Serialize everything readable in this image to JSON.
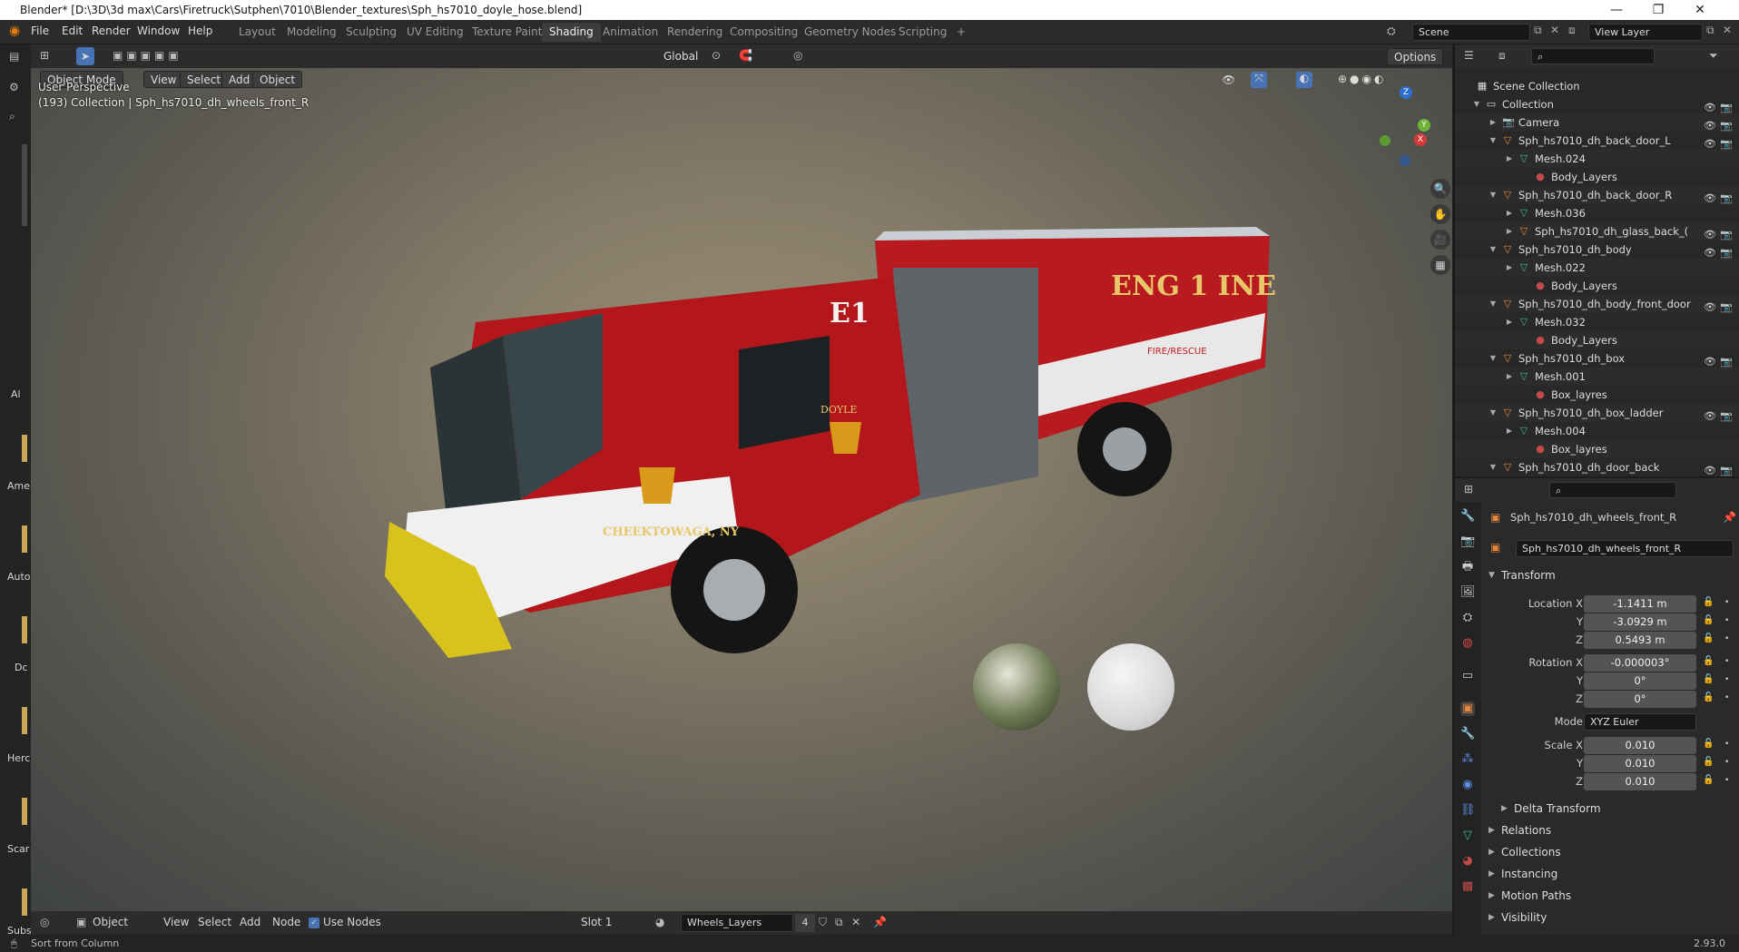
{
  "window": {
    "title": "Blender* [D:\\3D\\3d max\\Cars\\Firetruck\\Sutphen\\7010\\Blender_textures\\Sph_hs7010_doyle_hose.blend]",
    "minimize": "—",
    "maximize": "❐",
    "close": "✕"
  },
  "menu": [
    "File",
    "Edit",
    "Render",
    "Window",
    "Help"
  ],
  "workspaces": [
    "Layout",
    "Modeling",
    "Sculpting",
    "UV Editing",
    "Texture Paint",
    "Shading",
    "Animation",
    "Rendering",
    "Compositing",
    "Geometry Nodes",
    "Scripting",
    "+"
  ],
  "active_workspace": "Shading",
  "scene": {
    "name": "Scene",
    "view_layer": "View Layer"
  },
  "viewport_header": {
    "mode": "Object Mode",
    "menus": [
      "View",
      "Select",
      "Add",
      "Object"
    ],
    "orientation": "Global",
    "options": "Options"
  },
  "viewport": {
    "perspective": "User Perspective",
    "collection_info": "(193) Collection | Sph_hs7010_dh_wheels_front_R",
    "gizmo_axes": [
      "Z",
      "Y",
      "X"
    ]
  },
  "truck_text": {
    "unit": "E1",
    "engine": "ENG 1 INE",
    "rescue": "FIRE/RESCUE",
    "city": "CHEEKTOWAGA, NY",
    "company": "DOYLE"
  },
  "node_header": {
    "object": "Object",
    "menus": [
      "View",
      "Select",
      "Add",
      "Node"
    ],
    "use_nodes": "Use Nodes",
    "slot": "Slot 1",
    "material": "Wheels_Layers",
    "users": "4"
  },
  "left_toolbar_labels": [
    "Al",
    "Ame",
    "Auto",
    "Dc",
    "Herc",
    "Scar",
    "Subs"
  ],
  "status": {
    "left": "Sort from Column",
    "version": "2.93.0"
  },
  "outliner": {
    "root": "Scene Collection",
    "rows": [
      {
        "label": "Collection",
        "depth": 0,
        "icon": "collection",
        "vis": true
      },
      {
        "label": "Camera",
        "depth": 1,
        "icon": "camera",
        "vis": true
      },
      {
        "label": "Sph_hs7010_dh_back_door_L",
        "depth": 1,
        "icon": "object",
        "vis": true
      },
      {
        "label": "Mesh.024",
        "depth": 2,
        "icon": "mesh",
        "vis": false
      },
      {
        "label": "Body_Layers",
        "depth": 3,
        "icon": "material",
        "vis": false
      },
      {
        "label": "Sph_hs7010_dh_back_door_R",
        "depth": 1,
        "icon": "object",
        "vis": true
      },
      {
        "label": "Mesh.036",
        "depth": 2,
        "icon": "mesh",
        "vis": false
      },
      {
        "label": "Sph_hs7010_dh_glass_back_(",
        "depth": 2,
        "icon": "object",
        "vis": true
      },
      {
        "label": "Sph_hs7010_dh_body",
        "depth": 1,
        "icon": "object",
        "vis": true
      },
      {
        "label": "Mesh.022",
        "depth": 2,
        "icon": "mesh",
        "vis": false
      },
      {
        "label": "Body_Layers",
        "depth": 3,
        "icon": "material",
        "vis": false
      },
      {
        "label": "Sph_hs7010_dh_body_front_door",
        "depth": 1,
        "icon": "object",
        "vis": true
      },
      {
        "label": "Mesh.032",
        "depth": 2,
        "icon": "mesh",
        "vis": false
      },
      {
        "label": "Body_Layers",
        "depth": 3,
        "icon": "material",
        "vis": false
      },
      {
        "label": "Sph_hs7010_dh_box",
        "depth": 1,
        "icon": "object",
        "vis": true
      },
      {
        "label": "Mesh.001",
        "depth": 2,
        "icon": "mesh",
        "vis": false
      },
      {
        "label": "Box_layres",
        "depth": 3,
        "icon": "material",
        "vis": false
      },
      {
        "label": "Sph_hs7010_dh_box_ladder",
        "depth": 1,
        "icon": "object",
        "vis": true
      },
      {
        "label": "Mesh.004",
        "depth": 2,
        "icon": "mesh",
        "vis": false
      },
      {
        "label": "Box_layres",
        "depth": 3,
        "icon": "material",
        "vis": false
      },
      {
        "label": "Sph_hs7010_dh_door_back",
        "depth": 1,
        "icon": "object",
        "vis": true
      }
    ]
  },
  "properties": {
    "object_name": "Sph_hs7010_dh_wheels_front_R",
    "data_name": "Sph_hs7010_dh_wheels_front_R",
    "transform": "Transform",
    "location": {
      "label": "Location X",
      "x": "-1.1411 m",
      "y": "-3.0929 m",
      "z": "0.5493 m"
    },
    "rotation": {
      "label": "Rotation X",
      "x": "-0.000003°",
      "y": "0°",
      "z": "0°"
    },
    "mode": {
      "label": "Mode",
      "value": "XYZ Euler"
    },
    "scale": {
      "label": "Scale X",
      "x": "0.010",
      "y": "0.010",
      "z": "0.010"
    },
    "axis_y": "Y",
    "axis_z": "Z",
    "delta": "Delta Transform",
    "panels": [
      "Relations",
      "Collections",
      "Instancing",
      "Motion Paths",
      "Visibility"
    ]
  },
  "colors": {
    "accent": "#4772b3",
    "truck_red": "#b0151a",
    "object_orange": "#e8873a",
    "mesh_green": "#3fb88f",
    "material_red": "#c24a4a"
  }
}
